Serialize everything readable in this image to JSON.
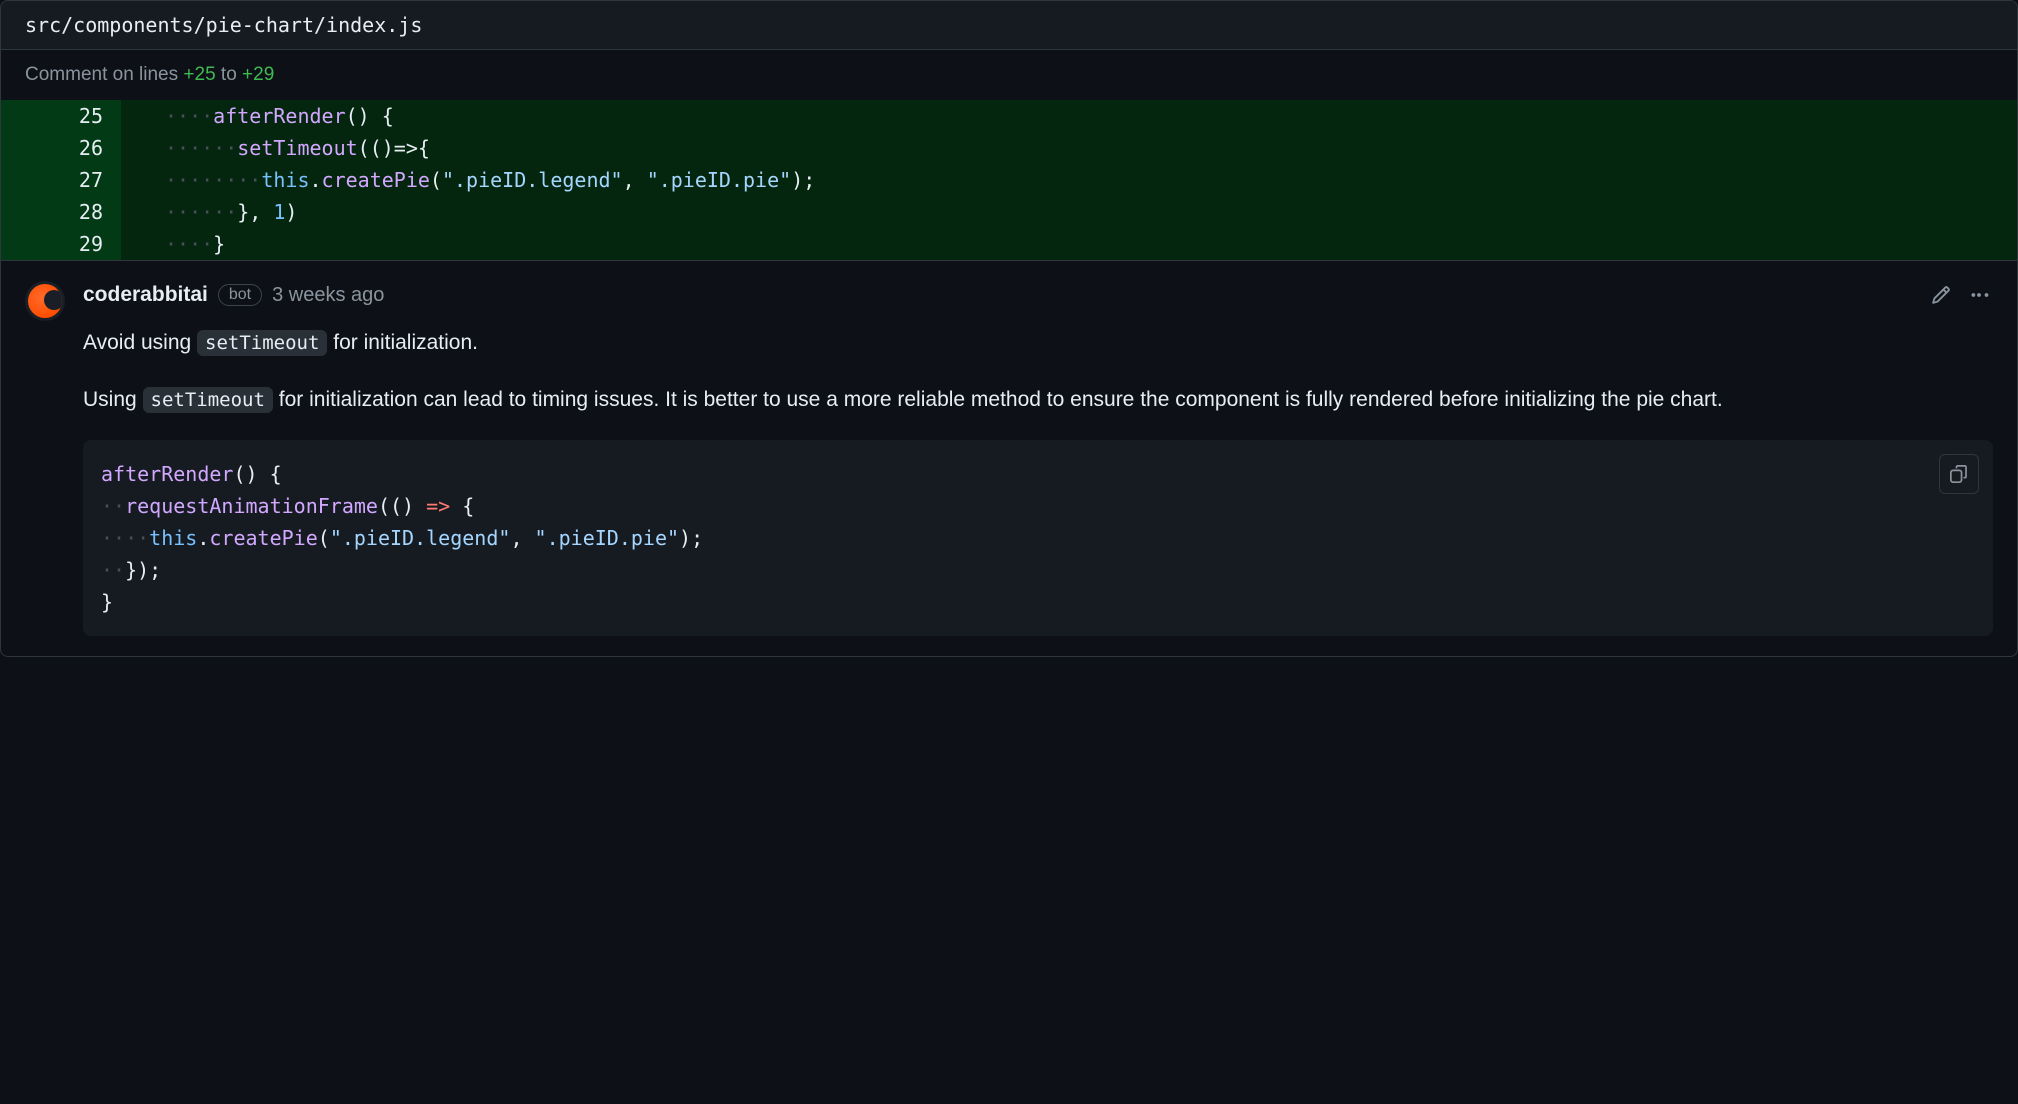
{
  "file_header": {
    "path": "src/components/pie-chart/index.js"
  },
  "comment_range": {
    "prefix": "Comment on lines ",
    "from": "+25",
    "sep": " to ",
    "to": "+29"
  },
  "diff": {
    "lines": [
      {
        "n": "25",
        "ws_pre": "····",
        "tokens": [
          {
            "cls": "fn",
            "t": "afterRender"
          },
          {
            "cls": "punct",
            "t": "() {"
          }
        ]
      },
      {
        "n": "26",
        "ws_pre": "······",
        "tokens": [
          {
            "cls": "hl",
            "t": "setTimeout"
          },
          {
            "cls": "punct",
            "t": "(()=>{"
          }
        ]
      },
      {
        "n": "27",
        "ws_pre": "········",
        "tokens": [
          {
            "cls": "this",
            "t": "this"
          },
          {
            "cls": "punct",
            "t": "."
          },
          {
            "cls": "fn",
            "t": "createPie"
          },
          {
            "cls": "punct",
            "t": "("
          },
          {
            "cls": "str",
            "t": "\".pieID.legend\""
          },
          {
            "cls": "punct",
            "t": ", "
          },
          {
            "cls": "str",
            "t": "\".pieID.pie\""
          },
          {
            "cls": "punct",
            "t": ");"
          }
        ]
      },
      {
        "n": "28",
        "ws_pre": "······",
        "tokens": [
          {
            "cls": "punct",
            "t": "}, "
          },
          {
            "cls": "num",
            "t": "1"
          },
          {
            "cls": "punct",
            "t": ")"
          }
        ]
      },
      {
        "n": "29",
        "ws_pre": "····",
        "tokens": [
          {
            "cls": "punct",
            "t": "}"
          }
        ]
      }
    ]
  },
  "comment": {
    "author": "coderabbitai",
    "badge": "bot",
    "time": "3 weeks ago",
    "p1_a": "Avoid using ",
    "p1_code": "setTimeout",
    "p1_b": " for initialization.",
    "p2_a": "Using ",
    "p2_code": "setTimeout",
    "p2_b": " for initialization can lead to timing issues. It is better to use a more reliable method to ensure the component is fully rendered before initializing the pie chart.",
    "suggestion": [
      {
        "ws": "",
        "tokens": [
          {
            "cls": "fn",
            "t": "afterRender"
          },
          {
            "cls": "punct",
            "t": "() {"
          }
        ]
      },
      {
        "ws": "··",
        "tokens": [
          {
            "cls": "hl",
            "t": "requestAnimationFrame"
          },
          {
            "cls": "punct",
            "t": "(() "
          },
          {
            "cls": "kw",
            "t": "=>"
          },
          {
            "cls": "punct",
            "t": " {"
          }
        ]
      },
      {
        "ws": "····",
        "tokens": [
          {
            "cls": "this",
            "t": "this"
          },
          {
            "cls": "punct",
            "t": "."
          },
          {
            "cls": "fn",
            "t": "createPie"
          },
          {
            "cls": "punct",
            "t": "("
          },
          {
            "cls": "str",
            "t": "\".pieID.legend\""
          },
          {
            "cls": "punct",
            "t": ", "
          },
          {
            "cls": "str",
            "t": "\".pieID.pie\""
          },
          {
            "cls": "punct",
            "t": ");"
          }
        ]
      },
      {
        "ws": "··",
        "tokens": [
          {
            "cls": "punct",
            "t": "});"
          }
        ]
      },
      {
        "ws": "",
        "tokens": [
          {
            "cls": "punct",
            "t": "}"
          }
        ]
      }
    ]
  }
}
